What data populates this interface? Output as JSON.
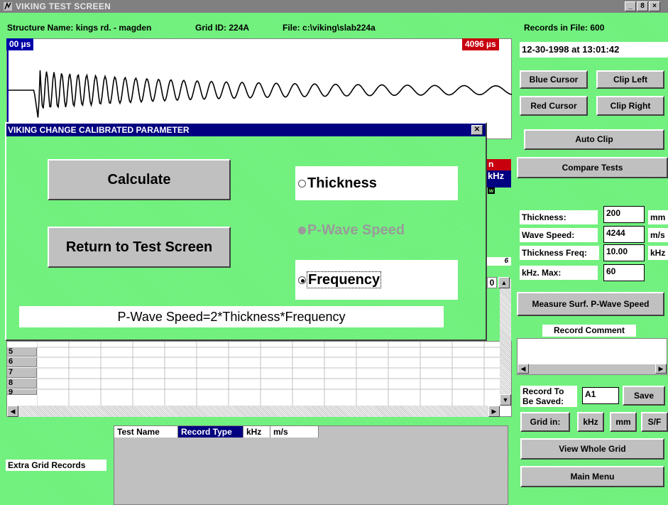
{
  "window": {
    "title": "VIKING TEST SCREEN",
    "controls": [
      "_",
      "8",
      "×"
    ]
  },
  "info": {
    "structure_label": "Structure Name:",
    "structure_value": "kings rd. - magden",
    "grid_label": "Grid ID:",
    "grid_value": "224A",
    "file_label": "File:",
    "file_value": "c:\\viking\\slab224a",
    "records_label": "Records in File:",
    "records_value": "600",
    "timestamp": "12-30-1998 at 13:01:42"
  },
  "waveform": {
    "start_label": "00 µs",
    "end_label": "4096 µs",
    "partial_red": "n",
    "partial_khz": "kHz",
    "partial_w": "w",
    "partial_num": "6"
  },
  "buttons": {
    "blue_cursor": "Blue Cursor",
    "clip_left": "Clip Left",
    "red_cursor": "Red Cursor",
    "clip_right": "Clip Right",
    "auto_clip": "Auto Clip",
    "compare_tests": "Compare Tests",
    "measure_surf": "Measure Surf. P-Wave Speed",
    "save": "Save",
    "grid_in": "Grid in:",
    "khz": "kHz",
    "mm": "mm",
    "sf": "S/F",
    "view_whole_grid": "View Whole Grid",
    "main_menu": "Main Menu"
  },
  "params": {
    "thickness_label": "Thickness:",
    "thickness_value": "200",
    "thickness_unit": "mm",
    "wave_speed_label": "Wave Speed:",
    "wave_speed_value": "4244",
    "wave_speed_unit": "m/s",
    "thickness_freq_label": "Thickness Freq:",
    "thickness_freq_value": "10.00",
    "thickness_freq_unit": "kHz",
    "khz_max_label": "kHz. Max:",
    "khz_max_value": "60"
  },
  "comment": {
    "label": "Record Comment",
    "value": ""
  },
  "record_save": {
    "label_line1": "Record To",
    "label_line2": "Be Saved:",
    "value": "A1"
  },
  "grid": {
    "row_labels": [
      "5",
      "6",
      "7",
      "8",
      "9"
    ],
    "partial_col": "0"
  },
  "extra_grid": {
    "label": "Extra Grid Records",
    "columns": [
      "Test Name",
      "Record Type",
      "kHz",
      "m/s"
    ],
    "selected_column": "Record Type"
  },
  "dialog": {
    "title": "VIKING CHANGE CALIBRATED PARAMETER",
    "calculate": "Calculate",
    "return": "Return to Test Screen",
    "options": [
      {
        "label": "Thickness",
        "selected": false,
        "enabled": true
      },
      {
        "label": "P-Wave Speed",
        "selected": false,
        "enabled": false
      },
      {
        "label": "Frequency",
        "selected": true,
        "enabled": true
      }
    ],
    "formula": "P-Wave Speed=2*Thickness*Frequency"
  },
  "colors": {
    "background": "#6df07a",
    "dialog_titlebar": "#000080",
    "time_start_bg": "#0000a8",
    "time_end_bg": "#c8000e"
  }
}
